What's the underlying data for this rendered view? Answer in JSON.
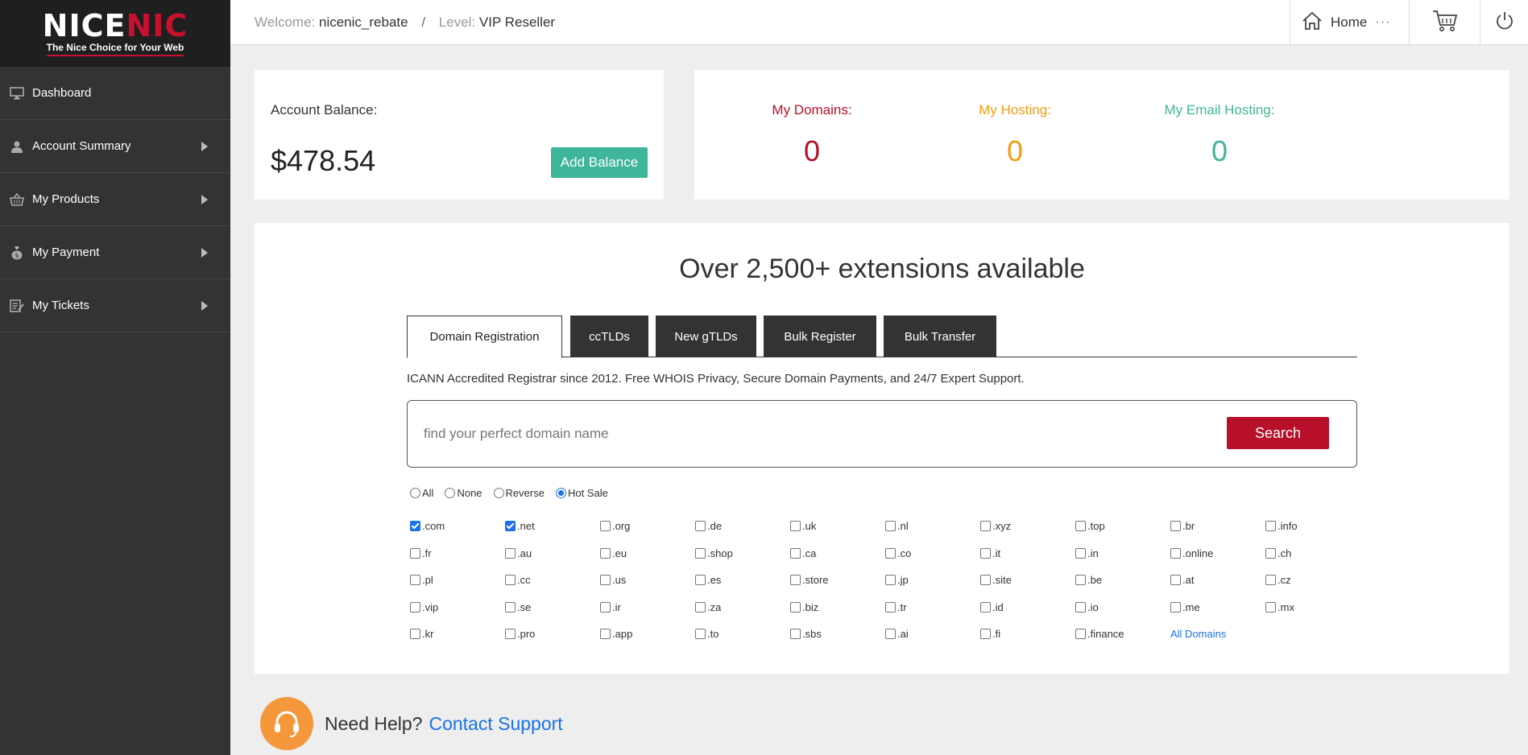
{
  "logo": {
    "part1": "NICE",
    "part2": "NIC",
    "tagline": "The Nice Choice for Your Web"
  },
  "sidebar": {
    "items": [
      {
        "label": "Dashboard"
      },
      {
        "label": "Account Summary"
      },
      {
        "label": "My Products"
      },
      {
        "label": "My Payment"
      },
      {
        "label": "My Tickets"
      }
    ]
  },
  "header": {
    "welcome_label": "Welcome:",
    "username": "nicenic_rebate",
    "separator": "/",
    "level_label": "Level:",
    "level_value": "VIP Reseller",
    "home_label": "Home",
    "more": "···"
  },
  "balance": {
    "label": "Account Balance:",
    "value": "$478.54",
    "add_button": "Add Balance"
  },
  "stats": [
    {
      "label": "My Domains:",
      "value": "0",
      "color": "#b8102a"
    },
    {
      "label": "My Hosting:",
      "value": "0",
      "color": "#f39c12"
    },
    {
      "label": "My Email Hosting:",
      "value": "0",
      "color": "#3fb59a"
    }
  ],
  "search": {
    "headline": "Over 2,500+ extensions available",
    "tabs": [
      "Domain Registration",
      "ccTLDs",
      "New gTLDs",
      "Bulk Register",
      "Bulk Transfer"
    ],
    "description": "ICANN Accredited Registrar since 2012. Free WHOIS Privacy, Secure Domain Payments, and 24/7 Expert Support.",
    "placeholder": "find your perfect domain name",
    "button": "Search",
    "filters": [
      {
        "label": "All",
        "selected": false
      },
      {
        "label": "None",
        "selected": false
      },
      {
        "label": "Reverse",
        "selected": false
      },
      {
        "label": "Hot Sale",
        "selected": true
      }
    ],
    "tlds": [
      [
        ".com",
        ".net",
        ".org",
        ".de",
        ".uk",
        ".nl",
        ".xyz",
        ".top",
        ".br",
        ".info"
      ],
      [
        ".fr",
        ".au",
        ".eu",
        ".shop",
        ".ca",
        ".co",
        ".it",
        ".in",
        ".online",
        ".ch"
      ],
      [
        ".pl",
        ".cc",
        ".us",
        ".es",
        ".store",
        ".jp",
        ".site",
        ".be",
        ".at",
        ".cz"
      ],
      [
        ".vip",
        ".se",
        ".ir",
        ".za",
        ".biz",
        ".tr",
        ".id",
        ".io",
        ".me",
        ".mx"
      ],
      [
        ".kr",
        ".pro",
        ".app",
        ".to",
        ".sbs",
        ".ai",
        ".fi",
        ".finance"
      ]
    ],
    "checked": [
      ".com",
      ".net"
    ],
    "all_domains": "All Domains"
  },
  "help": {
    "text": "Need Help?",
    "link": "Contact Support"
  }
}
